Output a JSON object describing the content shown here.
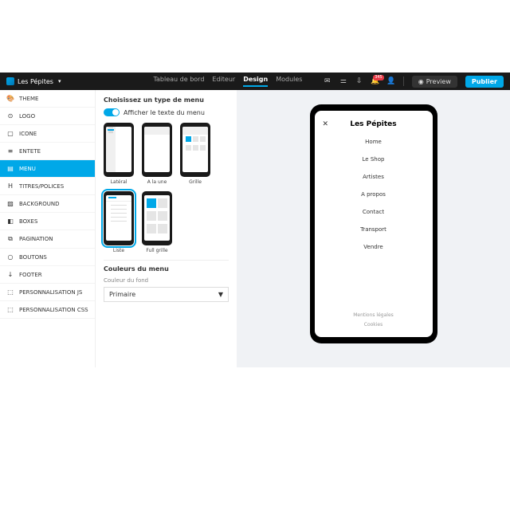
{
  "header": {
    "brand": "Les Pépites",
    "nav": [
      {
        "label": "Tableau de bord"
      },
      {
        "label": "Editeur"
      },
      {
        "label": "Design",
        "active": true
      },
      {
        "label": "Modules"
      }
    ],
    "bell_badge": "345",
    "preview": "Preview",
    "publish": "Publier"
  },
  "sidebar": [
    {
      "icon": "🎨",
      "label": "THEME"
    },
    {
      "icon": "⊙",
      "label": "LOGO"
    },
    {
      "icon": "▢",
      "label": "ICONE"
    },
    {
      "icon": "≡",
      "label": "ENTETE"
    },
    {
      "icon": "▤",
      "label": "MENU",
      "active": true
    },
    {
      "icon": "H",
      "label": "TITRES/POLICES"
    },
    {
      "icon": "▨",
      "label": "BACKGROUND"
    },
    {
      "icon": "◧",
      "label": "BOXES"
    },
    {
      "icon": "⧉",
      "label": "PAGINATION"
    },
    {
      "icon": "○",
      "label": "BOUTONS"
    },
    {
      "icon": "↓",
      "label": "FOOTER"
    },
    {
      "icon": "⬚",
      "label": "PERSONNALISATION JS"
    },
    {
      "icon": "⬚",
      "label": "PERSONNALISATION CSS"
    }
  ],
  "content": {
    "section_title": "Choisissez un type de menu",
    "toggle_label": "Afficher le texte du menu",
    "options": [
      {
        "label": "Latéral"
      },
      {
        "label": "A la une"
      },
      {
        "label": "Grille"
      },
      {
        "label": "Liste",
        "selected": true
      },
      {
        "label": "Full grille"
      }
    ],
    "colors_title": "Couleurs du menu",
    "bg_label": "Couleur du fond",
    "bg_value": "Primaire"
  },
  "preview": {
    "title": "Les Pépites",
    "items": [
      "Home",
      "Le Shop",
      "Artistes",
      "A propos",
      "Contact",
      "Transport",
      "Vendre"
    ],
    "footer": [
      "Mentions légales",
      "Cookies"
    ]
  }
}
